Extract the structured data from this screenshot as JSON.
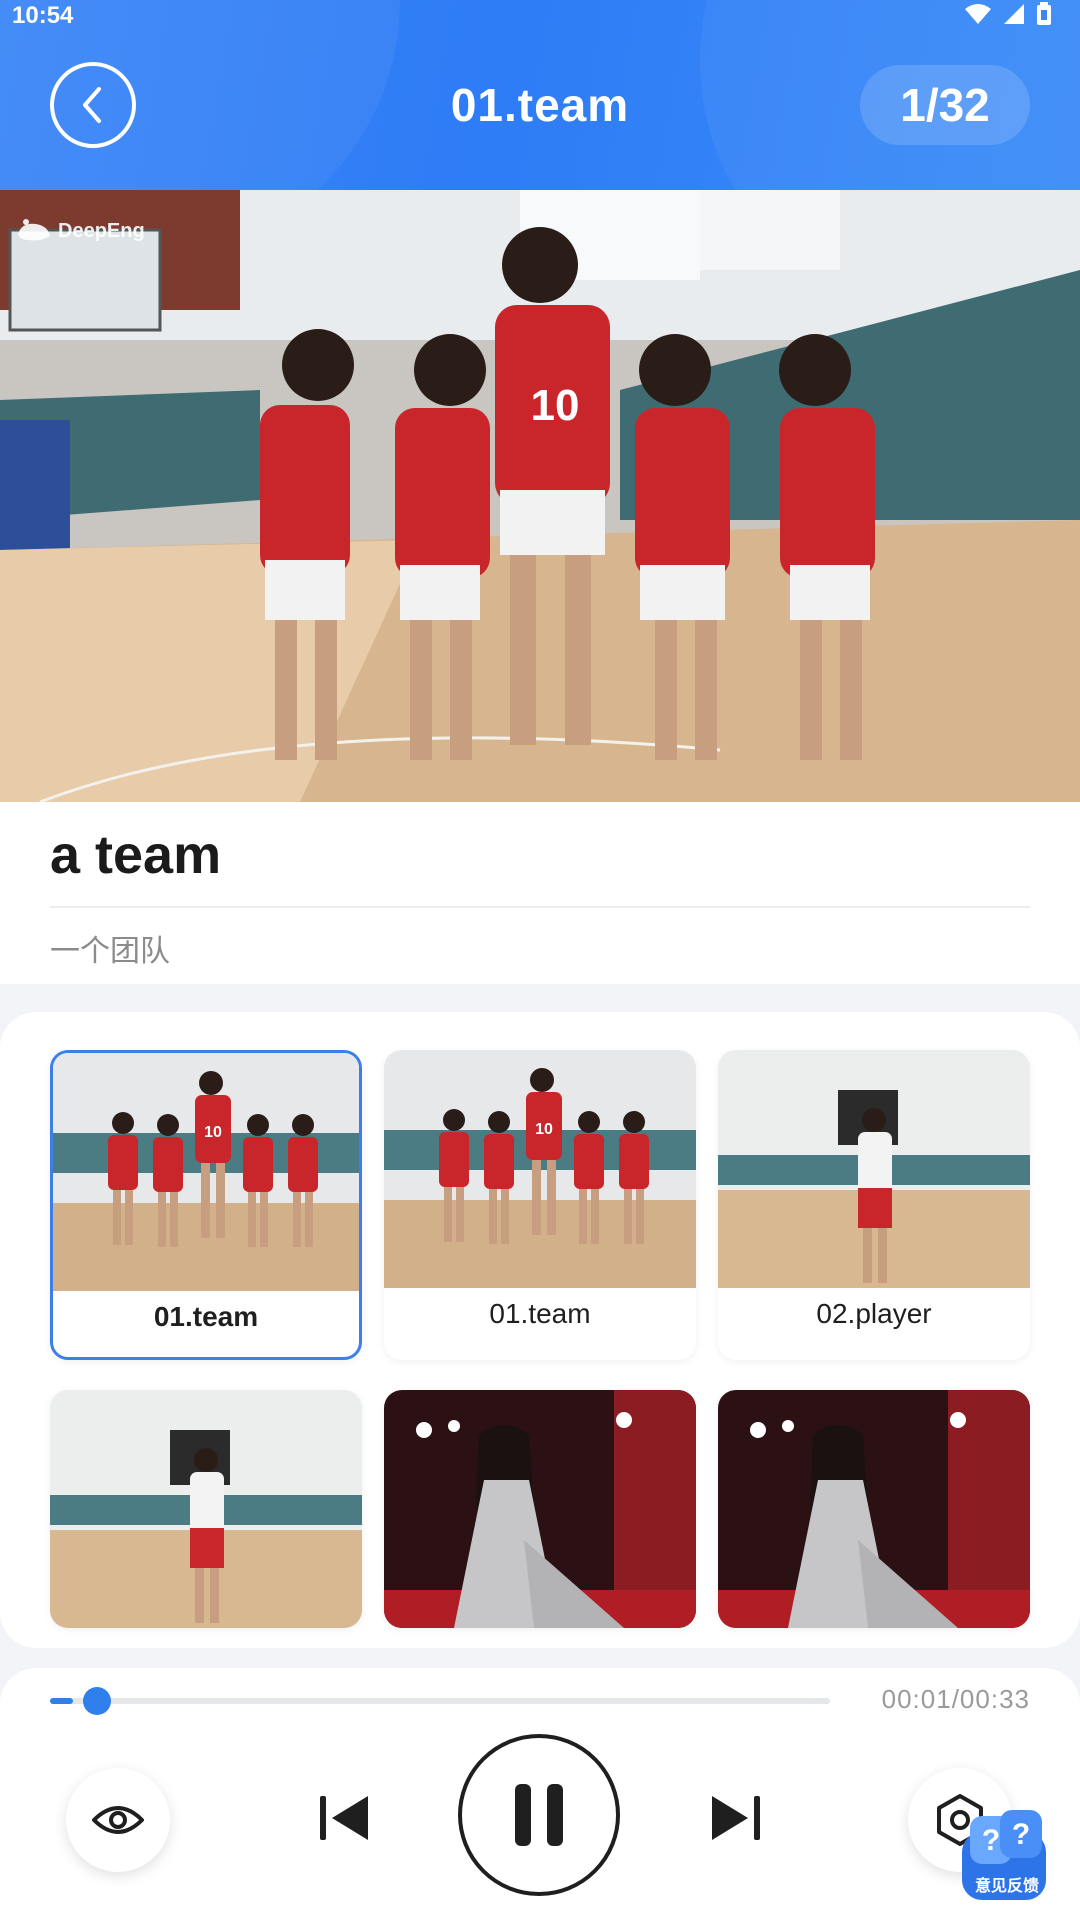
{
  "status_bar": {
    "time": "10:54"
  },
  "header": {
    "title": "01.team",
    "counter": "1/32"
  },
  "hero": {
    "watermark": "DeepEng"
  },
  "word": {
    "text": "a team",
    "meaning": "一个团队"
  },
  "thumbnails": [
    {
      "label": "01.team",
      "selected": true
    },
    {
      "label": "01.team",
      "selected": false
    },
    {
      "label": "02.player",
      "selected": false
    },
    {
      "label": "",
      "selected": false
    },
    {
      "label": "",
      "selected": false
    },
    {
      "label": "",
      "selected": false
    }
  ],
  "player": {
    "time": "00:01/00:33",
    "progress": 0.03
  },
  "feedback": {
    "label": "意见反馈"
  },
  "colors": {
    "accent": "#2f80ed",
    "header": "#3382f7"
  }
}
